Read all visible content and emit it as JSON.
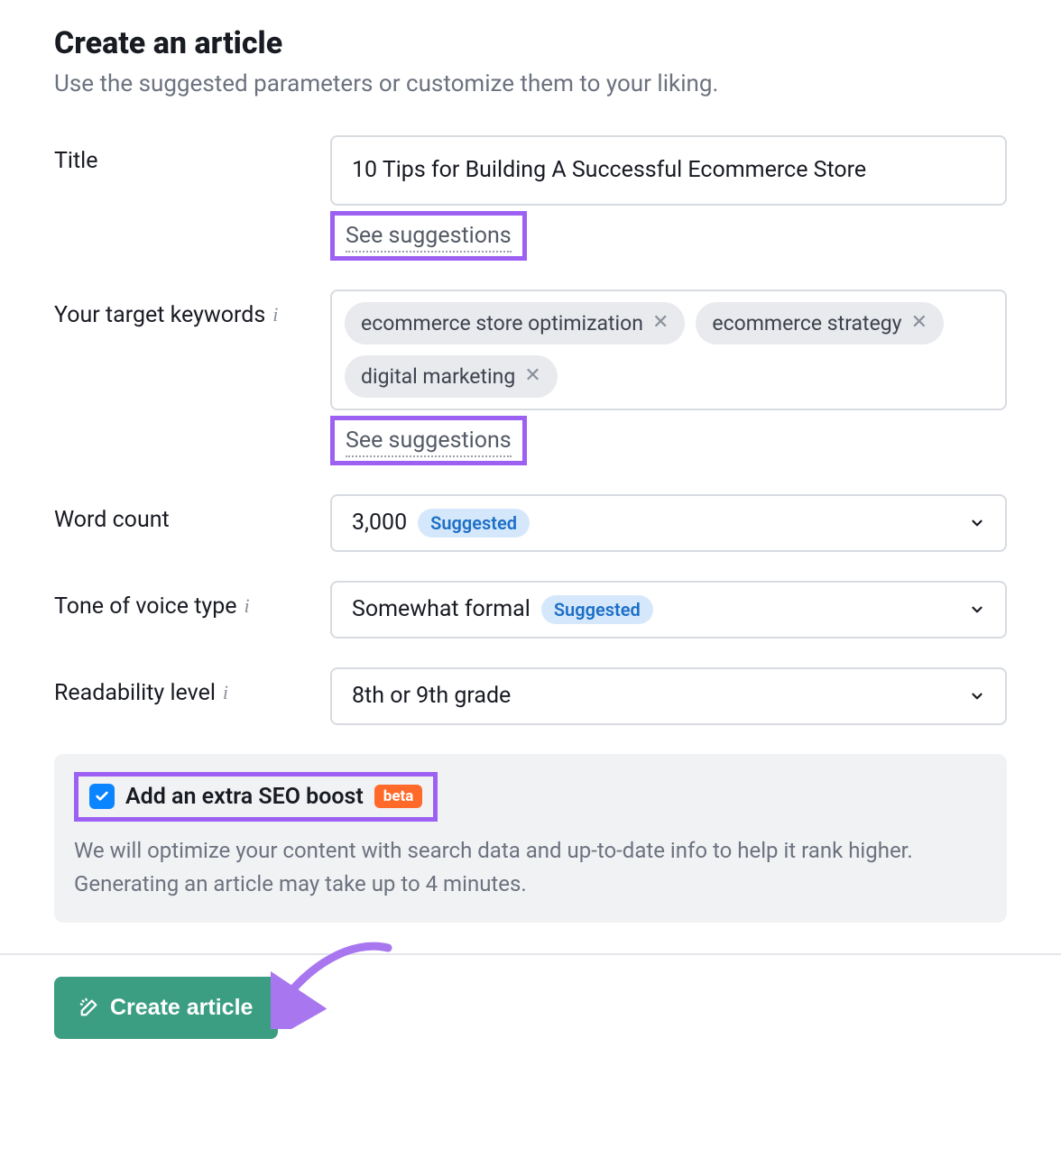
{
  "header": {
    "title": "Create an article",
    "subtitle": "Use the suggested parameters or customize them to your liking."
  },
  "fields": {
    "title_label": "Title",
    "title_value": "10 Tips for Building A Successful Ecommerce Store",
    "title_see_suggestions": "See suggestions",
    "keywords_label": "Your target keywords",
    "keywords": [
      "ecommerce store optimization",
      "ecommerce strategy",
      "digital marketing"
    ],
    "keywords_see_suggestions": "See suggestions",
    "wordcount_label": "Word count",
    "wordcount_value": "3,000",
    "wordcount_suggested": "Suggested",
    "tone_label": "Tone of voice type",
    "tone_value": "Somewhat formal",
    "tone_suggested": "Suggested",
    "readability_label": "Readability level",
    "readability_value": "8th or 9th grade"
  },
  "seo": {
    "checked": true,
    "label": "Add an extra SEO boost",
    "badge": "beta",
    "description": "We will optimize your content with search data and up-to-date info to help it rank higher. Generating an article may take up to 4 minutes."
  },
  "footer": {
    "create_label": "Create article"
  }
}
